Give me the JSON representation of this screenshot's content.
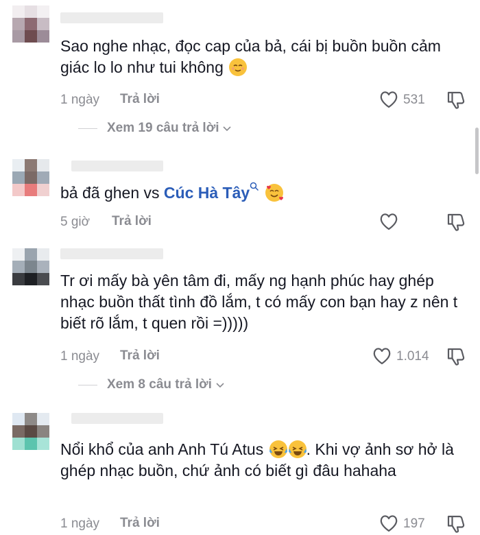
{
  "comments": [
    {
      "text": "Sao nghe nhạc, đọc cap của bả, cái bị buồn buồn cảm giác lo lo như tui không",
      "time": "1 ngày",
      "reply_label": "Trả lời",
      "likes": "531",
      "view_replies": "Xem 19 câu trả lời"
    },
    {
      "text_before": "bả đã ghen vs ",
      "mention": "Cúc Hà Tây",
      "time": "5 giờ",
      "reply_label": "Trả lời",
      "likes": ""
    },
    {
      "text": "Tr ơi mấy bà yên tâm đi, mấy ng hạnh phúc hay ghép nhạc buồn thất tình đồ lắm, t có mấy con bạn hay z nên t biết rõ lắm, t quen rồi =)))))",
      "time": "1 ngày",
      "reply_label": "Trả lời",
      "likes": "1.014",
      "view_replies": "Xem 8 câu trả lời"
    },
    {
      "text_before": "Nổi khổ của anh Anh Tú Atus ",
      "text_after": ". Khi vợ ảnh sơ hở là ghép nhạc buồn, chứ ảnh có biết gì đâu hahaha",
      "time": "1 ngày",
      "reply_label": "Trả lời",
      "likes": "197"
    }
  ],
  "icons": {
    "heart": "heart-outline-icon",
    "dislike": "thumbs-down-icon",
    "chevron": "chevron-down-icon",
    "search": "search-icon"
  },
  "colors": {
    "mention": "#2b5db8",
    "meta": "#8a8b91",
    "text": "#161823"
  }
}
